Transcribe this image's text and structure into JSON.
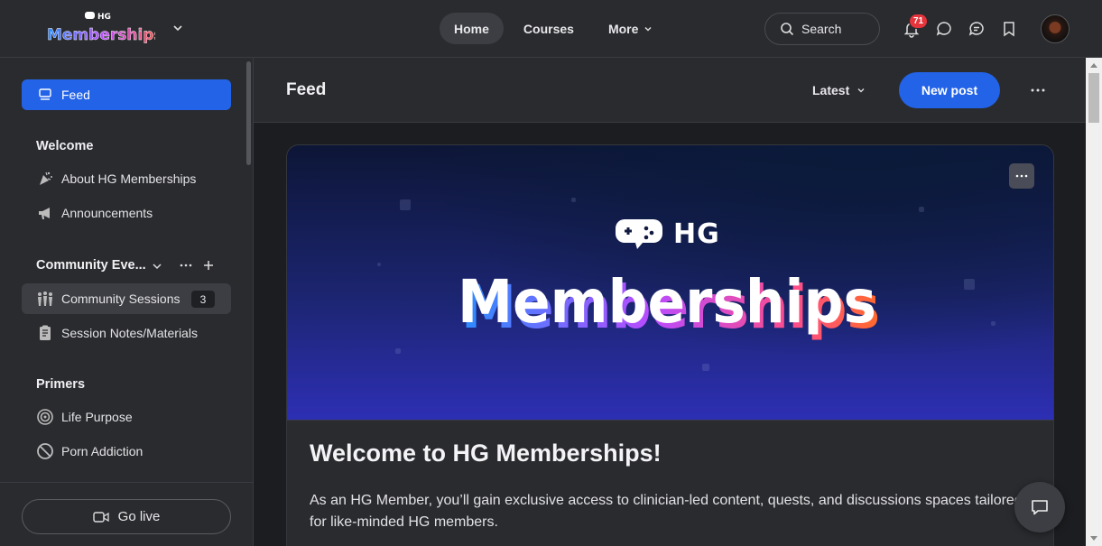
{
  "header": {
    "logo_small": "HG",
    "logo_main": "Memberships",
    "nav": [
      {
        "label": "Home",
        "active": true
      },
      {
        "label": "Courses",
        "active": false
      },
      {
        "label": "More",
        "active": false
      }
    ],
    "search_label": "Search",
    "notification_count": "71"
  },
  "sidebar": {
    "feed_label": "Feed",
    "sections": [
      {
        "heading": "Welcome",
        "items": [
          {
            "label": "About HG Memberships",
            "icon": "party-popper-icon"
          },
          {
            "label": "Announcements",
            "icon": "megaphone-icon"
          }
        ]
      },
      {
        "heading": "Community Eve...",
        "items": [
          {
            "label": "Community Sessions",
            "icon": "people-icon",
            "count": "3",
            "active": true
          },
          {
            "label": "Session Notes/Materials",
            "icon": "notes-icon"
          }
        ]
      },
      {
        "heading": "Primers",
        "items": [
          {
            "label": "Life Purpose",
            "icon": "target-icon"
          },
          {
            "label": "Porn Addiction",
            "icon": "no-entry-icon"
          }
        ]
      }
    ],
    "go_live_label": "Go live"
  },
  "main": {
    "title": "Feed",
    "sort_label": "Latest",
    "new_post_label": "New post",
    "post": {
      "banner_hg": "HG",
      "banner_word": "Memberships",
      "title": "Welcome to HG Memberships!",
      "body": "As an HG Member, you’ll gain exclusive access to clinician-led content, quests, and discussions spaces tailored for like-minded HG members."
    }
  },
  "colors": {
    "accent": "#2363e8",
    "badge": "#e5343b",
    "surface": "#2a2b2f"
  }
}
